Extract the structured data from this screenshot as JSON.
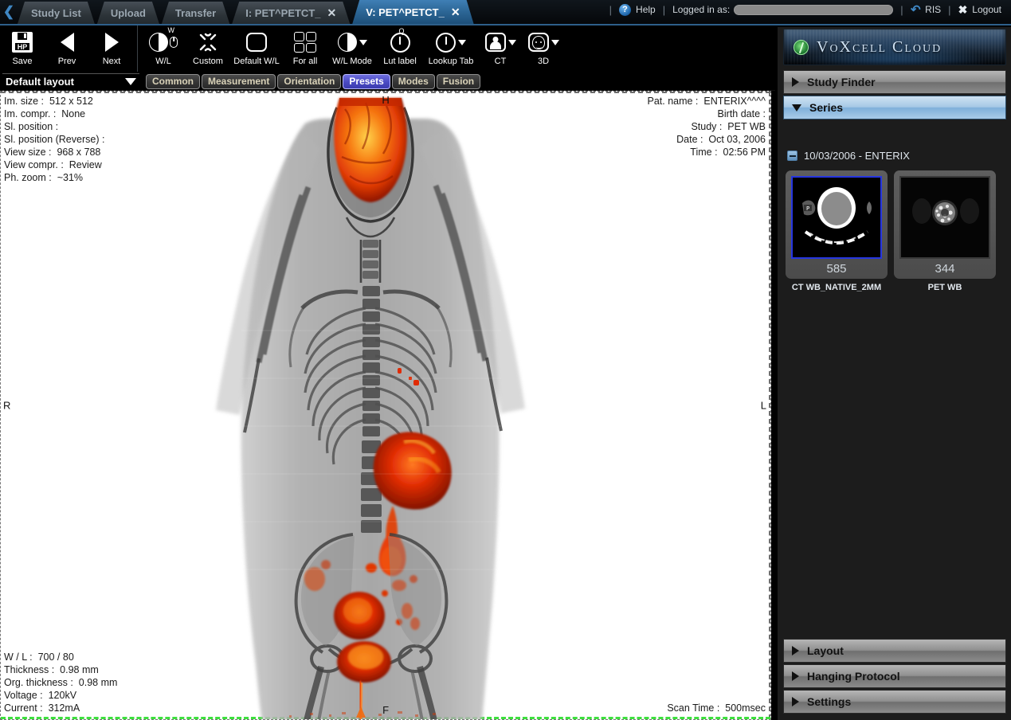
{
  "topbar": {
    "back_icon": "chevron-left-icon",
    "tabs": [
      {
        "label": "Study List",
        "active": false,
        "closable": false
      },
      {
        "label": "Upload",
        "active": false,
        "closable": false
      },
      {
        "label": "Transfer",
        "active": false,
        "closable": false
      },
      {
        "label": "I: PET^PETCT_",
        "active": false,
        "closable": true
      },
      {
        "label": "V: PET^PETCT_",
        "active": true,
        "closable": true
      }
    ],
    "close_glyph": "✕",
    "help_label": "Help",
    "help_glyph": "?",
    "logged_in_label": "Logged in as:",
    "logged_in_value": "",
    "ris_label": "RIS",
    "ris_glyph": "↷",
    "logout_label": "Logout",
    "logout_glyph": "✖",
    "separator": "|"
  },
  "toolbar": {
    "buttons": [
      {
        "label": "Save",
        "icon": "save-hp-icon",
        "sup": "",
        "caret": false
      },
      {
        "label": "Prev",
        "icon": "triangle-left-icon",
        "sup": "",
        "caret": false
      },
      {
        "label": "Next",
        "icon": "triangle-right-icon",
        "sup": "",
        "caret": false
      },
      {
        "label": "W/L",
        "icon": "window-level-mouse-icon",
        "sup": "W",
        "caret": false
      },
      {
        "label": "Custom",
        "icon": "custom-burst-icon",
        "sup": "",
        "caret": false
      },
      {
        "label": "Default W/L",
        "icon": "rounded-rect-icon",
        "sup": "",
        "caret": false
      },
      {
        "label": "For all",
        "icon": "four-panes-icon",
        "sup": "",
        "caret": false
      },
      {
        "label": "W/L Mode",
        "icon": "contrast-circle-icon",
        "sup": "",
        "caret": true
      },
      {
        "label": "Lut label",
        "icon": "gauge-icon",
        "sup": "Q",
        "caret": false
      },
      {
        "label": "Lookup Tab",
        "icon": "gauge-icon",
        "sup": "",
        "caret": true
      },
      {
        "label": "CT",
        "icon": "person-icon",
        "sup": "",
        "caret": true
      },
      {
        "label": "3D",
        "icon": "face-3d-icon",
        "sup": "",
        "caret": true
      }
    ],
    "layout_select": "Default layout",
    "layout_caret_icon": "chevron-down-icon",
    "preset_tabs": [
      {
        "label": "Common",
        "active": false
      },
      {
        "label": "Measurement",
        "active": false
      },
      {
        "label": "Orientation",
        "active": false
      },
      {
        "label": "Presets",
        "active": true
      },
      {
        "label": "Modes",
        "active": false
      },
      {
        "label": "Fusion",
        "active": false
      }
    ]
  },
  "viewport": {
    "overlay_top_left": [
      "Im. size :  512 x 512",
      "Im. compr. :  None",
      "Sl. position :",
      "Sl. position (Reverse) :",
      "View size :  968 x 788",
      "View compr. :  Review",
      "Ph. zoom :  ~31%"
    ],
    "overlay_top_right": [
      "Pat. name :  ENTERIX^^^^",
      "Birth date :",
      "Study :  PET WB",
      "Date :  Oct 03, 2006",
      "Time :  02:56 PM"
    ],
    "overlay_bottom_left": [
      "W / L :  700 / 80",
      "Thickness :  0.98 mm",
      "Org. thickness :  0.98 mm",
      "Voltage :  120kV",
      "Current :  312mA"
    ],
    "overlay_bottom_right": [
      "Scan Time :  500msec"
    ],
    "orientation": {
      "head": "H",
      "feet": "F",
      "right": "R",
      "left": "L"
    },
    "active_border_color": "#3de03d"
  },
  "sidebar": {
    "brand_title": "VoXcell Cloud",
    "brand_logo_icon": "leaf-logo-icon",
    "sections": [
      {
        "label": "Study Finder",
        "expanded": false,
        "selected": false
      },
      {
        "label": "Series",
        "expanded": true,
        "selected": true
      }
    ],
    "study_node": {
      "label": "10/03/2006 - ENTERIX",
      "toggle_icon": "minus-box-icon"
    },
    "series": [
      {
        "count": "585",
        "name": "CT WB_NATIVE_2MM",
        "selected": true,
        "thumb": "ct-head-axial"
      },
      {
        "count": "344",
        "name": "PET WB",
        "selected": false,
        "thumb": "pet-head-axial"
      }
    ],
    "bottom_sections": [
      {
        "label": "Layout",
        "expanded": false
      },
      {
        "label": "Hanging Protocol",
        "expanded": false
      },
      {
        "label": "Settings",
        "expanded": false
      }
    ]
  },
  "colors": {
    "accent_blue": "#2a6392",
    "selection_blue": "#2636e0",
    "active_green": "#3de03d",
    "preset_active": "#4a4ac2"
  }
}
